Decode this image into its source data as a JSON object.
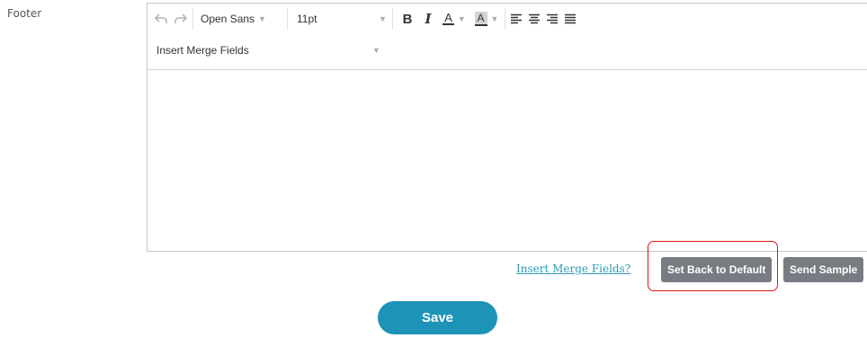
{
  "field": {
    "label": "Footer"
  },
  "editor": {
    "font_family": "Open Sans",
    "font_size": "11pt",
    "bold_label": "B",
    "italic_label": "I",
    "text_color_label": "A",
    "bg_color_label": "A",
    "merge_fields_value": "Insert Merge Fields"
  },
  "actions": {
    "merge_link": "Insert Merge Fields?",
    "default_button": "Set Back to Default",
    "sample_button": "Send Sample"
  },
  "footer": {
    "save_button": "Save"
  },
  "colors": {
    "accent": "#1d93b7",
    "link": "#2a9ab4",
    "secondary_button": "#767c82",
    "highlight": "#e0141c"
  }
}
